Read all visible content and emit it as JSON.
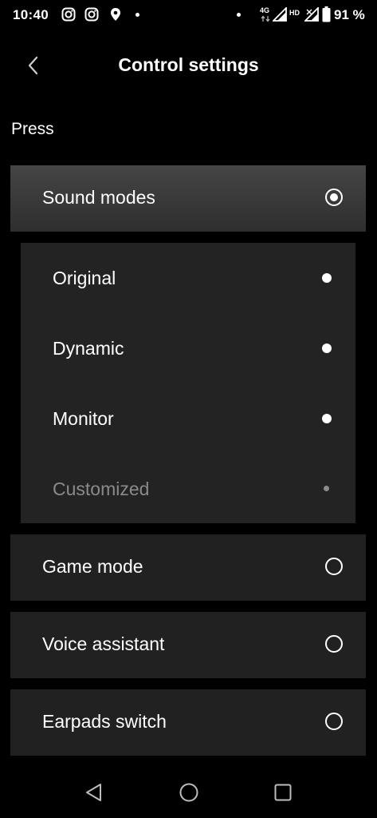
{
  "status_bar": {
    "time": "10:40",
    "network_type": "4G",
    "hd_label": "HD",
    "battery": "91 %"
  },
  "header": {
    "title": "Control settings",
    "back_icon": "chevron-left-icon"
  },
  "section": {
    "label": "Press"
  },
  "options": [
    {
      "label": "Sound modes",
      "selected": true
    },
    {
      "label": "Game mode",
      "selected": false
    },
    {
      "label": "Voice assistant",
      "selected": false
    },
    {
      "label": "Earpads switch",
      "selected": false
    }
  ],
  "sound_modes": [
    {
      "label": "Original",
      "enabled": true
    },
    {
      "label": "Dynamic",
      "enabled": true
    },
    {
      "label": "Monitor",
      "enabled": true
    },
    {
      "label": "Customized",
      "enabled": false
    }
  ],
  "nav_bar": {
    "back_icon": "triangle-back-icon",
    "home_icon": "circle-home-icon",
    "recents_icon": "square-recents-icon"
  },
  "colors": {
    "background": "#000000",
    "card": "#212121",
    "disabled_text": "#8a8a8a"
  }
}
